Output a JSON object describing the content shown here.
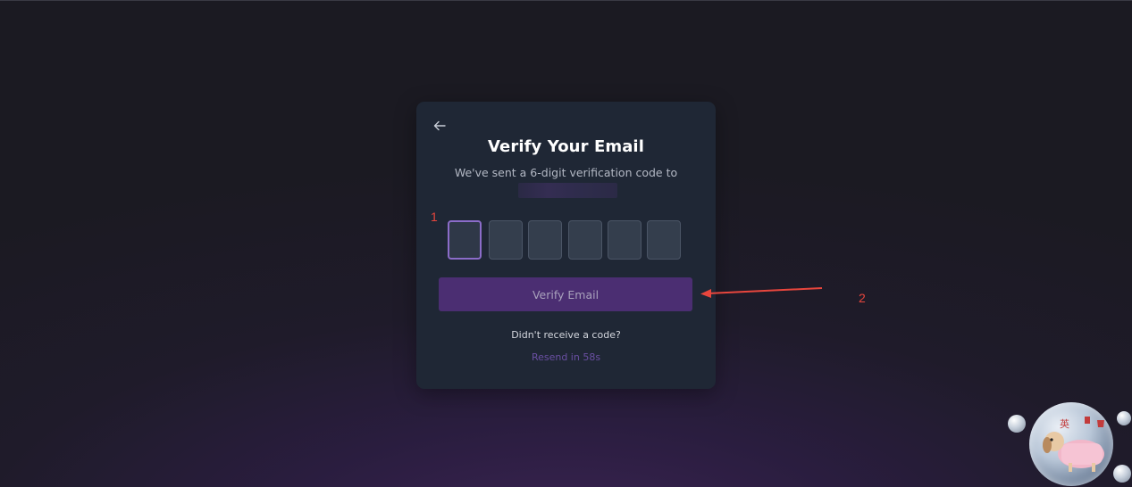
{
  "card": {
    "back_icon": "arrow-left-icon",
    "title": "Verify Your Email",
    "subtitle": "We've sent a 6-digit verification code to",
    "email": "",
    "code_digits": [
      "",
      "",
      "",
      "",
      "",
      ""
    ],
    "verify_button_label": "Verify Email",
    "no_code_text": "Didn't receive a code?",
    "resend_text": "Resend in 58s"
  },
  "annotations": {
    "marker_1": "1",
    "marker_2": "2"
  },
  "widget": {
    "icon": "puppy-mascot-icon",
    "badge_text": "英"
  },
  "colors": {
    "background": "#1b1a22",
    "card": "#1f2735",
    "accent": "#8b6cc9",
    "button": "#4b2e72",
    "resend": "#6a4fa3",
    "annotation": "#e8463d"
  }
}
